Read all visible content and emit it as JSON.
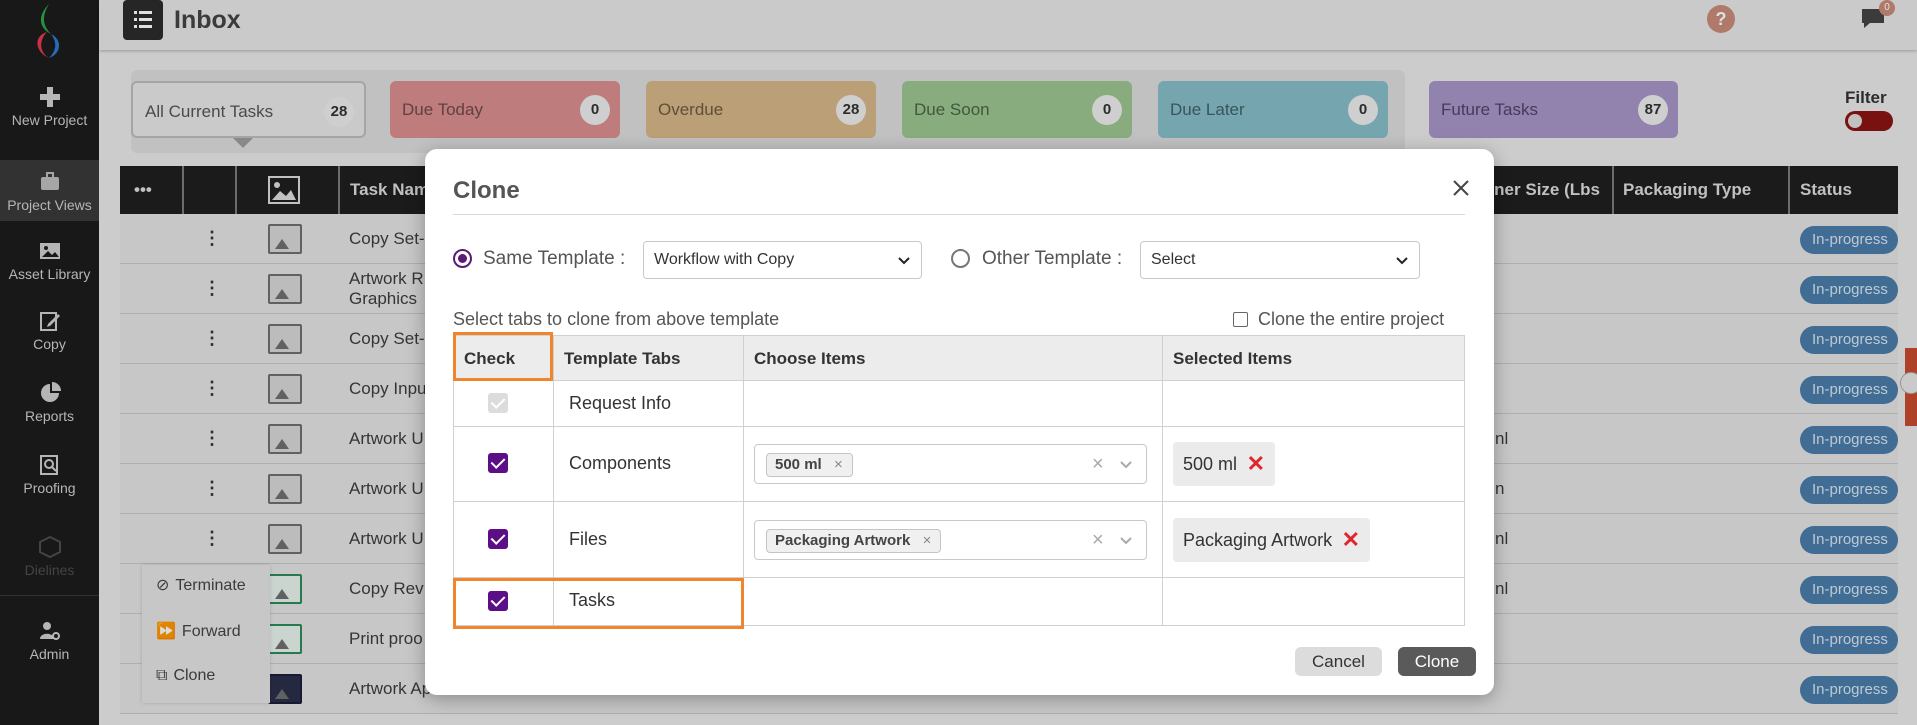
{
  "sidebar": {
    "items": [
      {
        "label": "New Project",
        "icon": "plus-icon"
      },
      {
        "label": "Project Views",
        "icon": "briefcase-icon"
      },
      {
        "label": "Asset Library",
        "icon": "image-icon"
      },
      {
        "label": "Copy",
        "icon": "edit-icon"
      },
      {
        "label": "Reports",
        "icon": "pie-chart-icon"
      },
      {
        "label": "Proofing",
        "icon": "zoom-doc-icon"
      },
      {
        "label": "Dielines",
        "icon": "cube-icon"
      },
      {
        "label": "Admin",
        "icon": "user-gear-icon"
      }
    ]
  },
  "header": {
    "title": "Inbox",
    "help": "?",
    "notifications": "0"
  },
  "task_cards": [
    {
      "label": "All Current Tasks",
      "count": "28"
    },
    {
      "label": "Due Today",
      "count": "0"
    },
    {
      "label": "Overdue",
      "count": "28"
    },
    {
      "label": "Due Soon",
      "count": "0"
    },
    {
      "label": "Due Later",
      "count": "0"
    },
    {
      "label": "Future Tasks",
      "count": "87"
    }
  ],
  "filter": {
    "label": "Filter"
  },
  "table": {
    "headers": {
      "more": "•••",
      "task_name": "Task Nam",
      "container": "ainer Size (Lbs",
      "packaging": "Packaging Type",
      "status": "Status"
    },
    "rows": [
      {
        "name": "Copy Set-",
        "extra": "",
        "status": "In-progress"
      },
      {
        "name": "Artwork R",
        "name2": "Graphics",
        "extra": "",
        "status": "In-progress"
      },
      {
        "name": "Copy Set-",
        "extra": "",
        "status": "In-progress"
      },
      {
        "name": "Copy Inpu",
        "extra": "",
        "status": "In-progress"
      },
      {
        "name": "Artwork U",
        "extra": "nl",
        "status": "In-progress"
      },
      {
        "name": "Artwork U",
        "extra": "n",
        "status": "In-progress"
      },
      {
        "name": "Artwork U",
        "extra": "nl",
        "status": "In-progress"
      },
      {
        "name": "Copy Rev",
        "extra": "nl",
        "status": "In-progress"
      },
      {
        "name": "Print proo",
        "extra": "",
        "status": "In-progress"
      },
      {
        "name": "Artwork Ap",
        "extra": "",
        "status": "In-progress"
      }
    ]
  },
  "context_menu": {
    "items": [
      "Terminate",
      "Forward",
      "Clone"
    ]
  },
  "modal": {
    "title": "Clone",
    "same_template_label": "Same Template :",
    "same_template_value": "Workflow with Copy",
    "other_template_label": "Other Template :",
    "other_template_value": "Select",
    "hint": "Select tabs to clone from above template",
    "clone_entire_label": "Clone the entire project",
    "columns": [
      "Check",
      "Template Tabs",
      "Choose Items",
      "Selected Items"
    ],
    "rows": [
      {
        "tab": "Request Info",
        "checked": true,
        "disabled": true
      },
      {
        "tab": "Components",
        "checked": true,
        "chip": "500 ml",
        "selected": "500 ml"
      },
      {
        "tab": "Files",
        "checked": true,
        "chip": "Packaging Artwork",
        "selected": "Packaging Artwork"
      },
      {
        "tab": "Tasks",
        "checked": true
      }
    ],
    "chip_remove": "×",
    "clear_mark": "×",
    "selected_remove": "✕",
    "cancel_label": "Cancel",
    "clone_label": "Clone"
  },
  "colors": {
    "accent_purple": "#5c0e86",
    "highlight_orange": "#f0852d",
    "remove_red": "#e0262d"
  }
}
